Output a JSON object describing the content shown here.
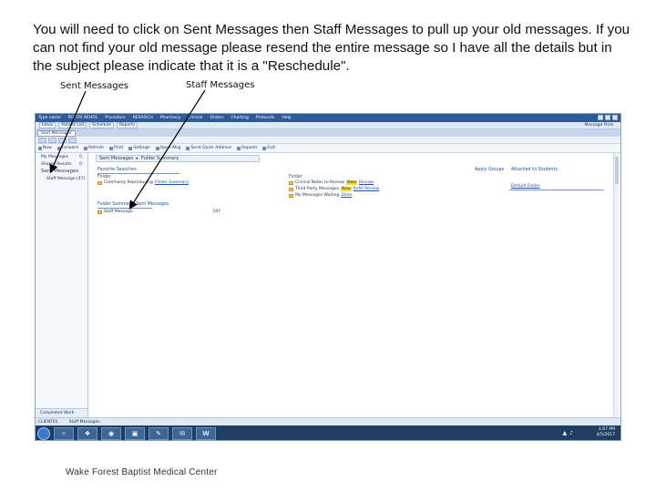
{
  "slide": {
    "instructions": "You will need to click on Sent Messages then Staff Messages to pull up your old messages. If you can not find your old message please resend the entire message so I have all the details but in the subject please indicate that it is a \"Reschedule\".",
    "callout_sent": "Sent Messages",
    "callout_staff": "Staff Messages",
    "footer": "Wake Forest Baptist Medical Center"
  },
  "app": {
    "titlebar": {
      "items": [
        "Type name",
        "PECTRI AEHOL",
        "Procedure",
        "RESAOCH",
        "Pharmacy",
        "Clinical",
        "Orders",
        "Charting",
        "Protocols",
        "Help"
      ]
    },
    "menubar": {
      "tabs": [
        "Inbox",
        "Patient List",
        "Schedule",
        "Reports"
      ],
      "right": "Message   Print"
    },
    "tab_active": "Sent Messages",
    "toolbar2": {
      "items": [
        "New",
        "Forward",
        "Refresh",
        "Print",
        "Settings",
        "Open Msg",
        "Send Quick Address",
        "Reports",
        "Exit"
      ]
    },
    "left_folders": [
      {
        "label": "My Messages",
        "count": "0",
        "big": false,
        "sub": false
      },
      {
        "label": "Shared Results",
        "count": "0",
        "big": false,
        "sub": false
      },
      {
        "label": "Sent Messages",
        "count": "",
        "big": true,
        "sub": false
      },
      {
        "label": "Staff Message (47)",
        "count": "",
        "big": false,
        "sub": true
      }
    ],
    "completed_work": "Completed Work",
    "breadcrumb": {
      "part1": "Sent Messages",
      "sep": "▸",
      "part2": "Folder Summary"
    },
    "favorites": {
      "title": "Favorite Searches",
      "col": "Folder",
      "row_label": "Commonly Reproducing",
      "row_link": "Folder Summary"
    },
    "folder_summary": {
      "title": "Folder Summary: Sent Messages",
      "row_label": "Staff Message",
      "row_count": "197"
    },
    "middle": {
      "col": "Folder",
      "rows": [
        {
          "label": "Clinical Notes to Review",
          "badge": "New",
          "link": "Review"
        },
        {
          "label": "Third Party Messages",
          "badge": "New",
          "link": "Refill Review"
        },
        {
          "label": "My Messages Waiting",
          "badge": "",
          "link": "Done"
        }
      ]
    },
    "right": {
      "label1": "Apply Groups",
      "label2": "Attached to Students",
      "link": "Default Folder"
    },
    "statusbar": {
      "left": "CLIENT01",
      "right": "Staff Messages"
    },
    "taskbar": {
      "apps": [
        "e",
        "❖",
        "◉",
        "▣",
        "✎",
        "✉",
        "W"
      ],
      "time": "1:07 PM",
      "date": "4/5/2017"
    }
  },
  "colors": {
    "title_blue": "#2e5a97",
    "accent_link": "#1f4fb0",
    "taskbar": "#1f3e62",
    "badge_yellow": "#f6d840"
  }
}
